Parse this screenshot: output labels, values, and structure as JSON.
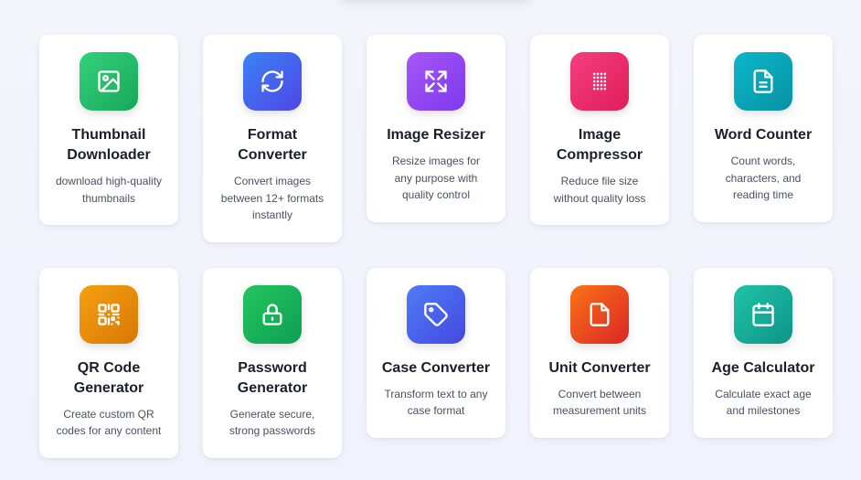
{
  "tools": [
    {
      "title": "Thumbnail Downloader",
      "desc": "download high-quality thumbnails",
      "icon": "image-icon",
      "c1": "#34d17b",
      "c2": "#16a85a"
    },
    {
      "title": "Format Converter",
      "desc": "Convert images between 12+ formats instantly",
      "icon": "refresh-icon",
      "c1": "#3b82f6",
      "c2": "#4f46e5"
    },
    {
      "title": "Image Resizer",
      "desc": "Resize images for any purpose with quality control",
      "icon": "expand-icon",
      "c1": "#a855f7",
      "c2": "#7c3aed"
    },
    {
      "title": "Image Compressor",
      "desc": "Reduce file size without quality loss",
      "icon": "grid-dots-icon",
      "c1": "#f43f7e",
      "c2": "#e11d5b"
    },
    {
      "title": "Word Counter",
      "desc": "Count words, characters, and reading time",
      "icon": "document-icon",
      "c1": "#0ab7c9",
      "c2": "#0891a3"
    },
    {
      "title": "QR Code Generator",
      "desc": "Create custom QR codes for any content",
      "icon": "qr-code-icon",
      "c1": "#f5a00f",
      "c2": "#d97706"
    },
    {
      "title": "Password Generator",
      "desc": "Generate secure, strong passwords",
      "icon": "lock-icon",
      "c1": "#22c55e",
      "c2": "#0e9f55"
    },
    {
      "title": "Case Converter",
      "desc": "Transform text to any case format",
      "icon": "tag-icon",
      "c1": "#4f7cf6",
      "c2": "#4548e0"
    },
    {
      "title": "Unit Converter",
      "desc": "Convert between measurement units",
      "icon": "file-icon",
      "c1": "#f97316",
      "c2": "#dc2626"
    },
    {
      "title": "Age Calculator",
      "desc": "Calculate exact age and milestones",
      "icon": "calendar-icon",
      "c1": "#20c3a8",
      "c2": "#0d9488"
    }
  ]
}
